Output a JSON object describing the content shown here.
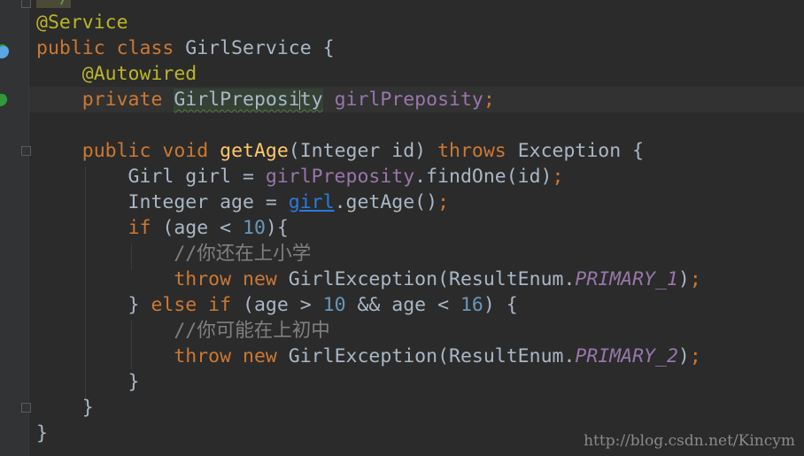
{
  "colors": {
    "keyword": "#cc7832",
    "annotation": "#bbb529",
    "default": "#a9b7c6",
    "method": "#ffc66d",
    "field": "#9876aa",
    "number": "#6897bb",
    "comment": "#808080",
    "background": "#2b2b2b",
    "gutter": "#313335"
  },
  "gutter_icons": [
    "class-implementation-icon",
    "field-injection-icon"
  ],
  "code": {
    "lines": [
      [
        {
          "t": " */",
          "c": "topcmt"
        }
      ],
      [
        {
          "t": "@Service",
          "c": "ann"
        }
      ],
      [
        {
          "t": "public class ",
          "c": "kw"
        },
        {
          "t": "GirlService {",
          "c": "def"
        }
      ],
      [
        {
          "t": "    "
        },
        {
          "t": "@Autowired",
          "c": "ann"
        }
      ],
      [
        {
          "t": "    "
        },
        {
          "t": "private ",
          "c": "kw"
        },
        {
          "t": "GirlPreposi",
          "c": "hl"
        },
        {
          "t": "",
          "c": "caret"
        },
        {
          "t": "ty",
          "c": "hl"
        },
        {
          "t": " "
        },
        {
          "t": "girlPreposity",
          "c": "fld"
        },
        {
          "t": ";",
          "c": "kw"
        }
      ],
      [],
      [
        {
          "t": "    "
        },
        {
          "t": "public void ",
          "c": "kw"
        },
        {
          "t": "getAge",
          "c": "md"
        },
        {
          "t": "(Integer id) "
        },
        {
          "t": "throws ",
          "c": "kw"
        },
        {
          "t": "Exception {"
        }
      ],
      [
        {
          "t": "        Girl girl = "
        },
        {
          "t": "girlPreposity",
          "c": "fld"
        },
        {
          "t": ".findOne(id)"
        },
        {
          "t": ";",
          "c": "kw"
        }
      ],
      [
        {
          "t": "        Integer age = "
        },
        {
          "t": "girl",
          "c": "link"
        },
        {
          "t": ".getAge()"
        },
        {
          "t": ";",
          "c": "kw"
        }
      ],
      [
        {
          "t": "        "
        },
        {
          "t": "if ",
          "c": "kw"
        },
        {
          "t": "(age < "
        },
        {
          "t": "10",
          "c": "num"
        },
        {
          "t": "){"
        }
      ],
      [
        {
          "t": "            "
        },
        {
          "t": "//你还在上小学",
          "c": "cmt"
        }
      ],
      [
        {
          "t": "            "
        },
        {
          "t": "throw new ",
          "c": "kw"
        },
        {
          "t": "GirlException(ResultEnum."
        },
        {
          "t": "PRIMARY_1",
          "c": "st"
        },
        {
          "t": ")"
        },
        {
          "t": ";",
          "c": "kw"
        }
      ],
      [
        {
          "t": "        } "
        },
        {
          "t": "else if ",
          "c": "kw"
        },
        {
          "t": "(age > "
        },
        {
          "t": "10",
          "c": "num"
        },
        {
          "t": " && age < "
        },
        {
          "t": "16",
          "c": "num"
        },
        {
          "t": ") {"
        }
      ],
      [
        {
          "t": "            "
        },
        {
          "t": "//你可能在上初中",
          "c": "cmt"
        }
      ],
      [
        {
          "t": "            "
        },
        {
          "t": "throw new ",
          "c": "kw"
        },
        {
          "t": "GirlException(ResultEnum."
        },
        {
          "t": "PRIMARY_2",
          "c": "st"
        },
        {
          "t": ")"
        },
        {
          "t": ";",
          "c": "kw"
        }
      ],
      [
        {
          "t": "        }"
        }
      ],
      [
        {
          "t": "    }"
        }
      ],
      [
        {
          "t": "}"
        }
      ]
    ],
    "current_line": 4
  },
  "watermark": "http://blog.csdn.net/Kincym"
}
